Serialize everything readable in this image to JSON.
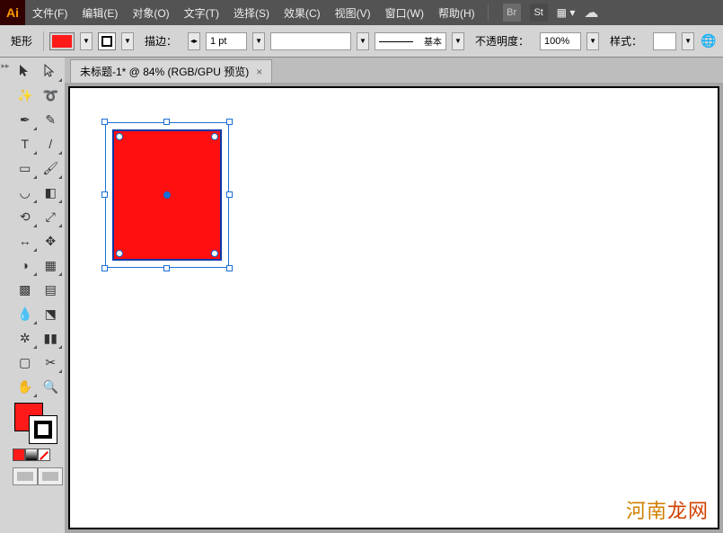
{
  "app": {
    "logo": "Ai"
  },
  "menu": {
    "file": "文件(F)",
    "edit": "编辑(E)",
    "object": "对象(O)",
    "type": "文字(T)",
    "select": "选择(S)",
    "effect": "效果(C)",
    "view": "视图(V)",
    "window": "窗口(W)",
    "help": "帮助(H)",
    "br_badge": "Br",
    "st_badge": "St"
  },
  "control": {
    "shape_label": "矩形",
    "fill_color": "#ff1a1a",
    "stroke_label": "描边：",
    "stroke_weight": "1 pt",
    "brush_profile_label": "基本",
    "opacity_label": "不透明度：",
    "opacity_value": "100%",
    "style_label": "样式："
  },
  "doc": {
    "tab_title": "未标题-1* @ 84% (RGB/GPU 预览)",
    "tab_close": "×"
  },
  "object": {
    "fill": "#ff0f0f",
    "stroke": "#0a37a8"
  },
  "watermark": {
    "a": "河南",
    "b": "龙网"
  }
}
